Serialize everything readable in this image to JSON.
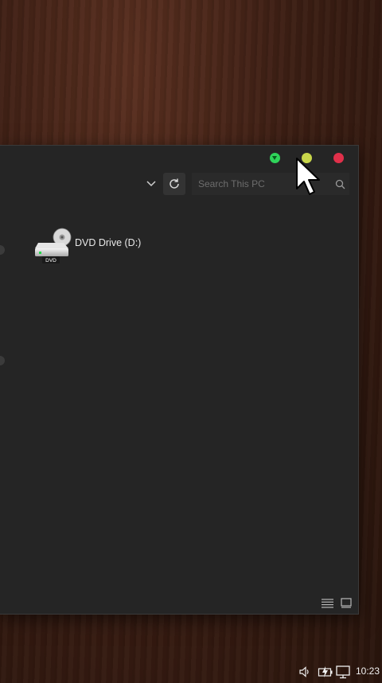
{
  "window": {
    "controls": {
      "green_icon": "chevron-down-icon",
      "yellow_icon": "minimize-icon",
      "red_icon": "close-icon",
      "colors": {
        "green": "#2fd35a",
        "yellow": "#c8d64a",
        "red": "#e0304a"
      }
    },
    "toolbar": {
      "dropdown_icon": "chevron-down-icon",
      "refresh_icon": "refresh-icon",
      "search": {
        "placeholder": "Search This PC",
        "value": ""
      },
      "search_icon": "search-icon"
    },
    "content": {
      "items": [
        {
          "label": "DVD Drive (D:)",
          "icon_badge": "DVD",
          "icon": "dvd-drive-icon"
        }
      ]
    },
    "statusbar": {
      "list_view_icon": "list-view-icon",
      "tile_view_icon": "tile-view-icon"
    }
  },
  "taskbar": {
    "time": "10:23 I",
    "tray_icons": [
      "speaker-icon",
      "battery-icon",
      "display-icon"
    ]
  }
}
